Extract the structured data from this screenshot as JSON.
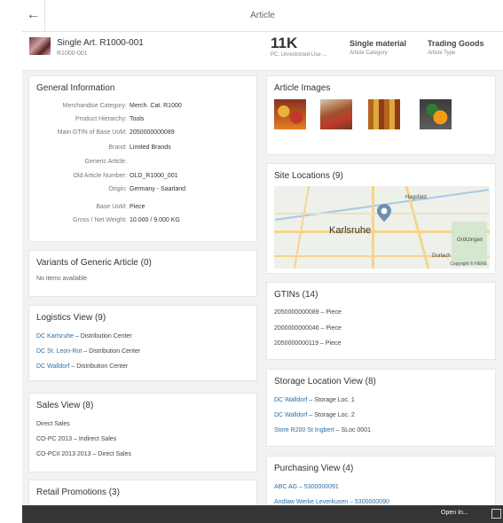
{
  "topbar": {
    "title": "Article",
    "back_icon": "arrow-left-icon"
  },
  "header": {
    "title": "Single Art. R1000-001",
    "subtitle": "R1000-001",
    "kpi_value": "11K",
    "kpi_label": "PC, Unrestricted-Use ...",
    "category_value": "Single material",
    "category_label": "Article Category",
    "type_value": "Trading Goods",
    "type_label": "Article Type"
  },
  "general_info": {
    "title": "General Information",
    "rows": [
      {
        "label": "Merchandise Category:",
        "value": "Merch. Cat. R1000"
      },
      {
        "label": "Product Hierarchy:",
        "value": "Tools"
      },
      {
        "label": "Main GTIN of Base UoM:",
        "value": "2050000000089"
      },
      {
        "label": "Brand:",
        "value": "Limited Brands"
      },
      {
        "label": "Generic Article:",
        "value": ""
      },
      {
        "label": "Old Article Number:",
        "value": "OLD_R1000_001"
      },
      {
        "label": "Origin:",
        "value": "Germany - Saarland"
      },
      {
        "label": "Base UoM:",
        "value": "Piece"
      },
      {
        "label": "Gross / Net Weight:",
        "value": "10.000 / 9.000 KG"
      }
    ]
  },
  "variants": {
    "title": "Variants of Generic Article (0)",
    "empty_text": "No items available"
  },
  "logistics": {
    "title": "Logistics View (9)",
    "items": [
      {
        "link": "DC Karlsruhe",
        "rest": " – Distribution Center"
      },
      {
        "link": "DC St. Leon-Rot",
        "rest": " – Distribution Center"
      },
      {
        "link": "DC Walldorf",
        "rest": " – Distribution Center"
      }
    ]
  },
  "sales": {
    "title": "Sales View (8)",
    "items": [
      {
        "text": "Direct Sales"
      },
      {
        "text": "CO-PC 2013 – Indirect Sales"
      },
      {
        "text": "CO-PCII 2013 2013 – Direct Sales"
      }
    ]
  },
  "retail": {
    "title": "Retail Promotions (3)"
  },
  "article_images": {
    "title": "Article Images"
  },
  "site_locations": {
    "title": "Site Locations (9)",
    "city": "Karlsruhe",
    "labels": {
      "north": "Hagsfeld",
      "east": "Grötzingen",
      "south": "Durlach"
    },
    "copyright": "Copyright © HERE"
  },
  "gtins": {
    "title": "GTINs (14)",
    "items": [
      {
        "text": "2050000000089 – Piece"
      },
      {
        "text": "2000000000046 – Piece"
      },
      {
        "text": "2050000000119 – Piece"
      }
    ]
  },
  "storage": {
    "title": "Storage Location View (8)",
    "items": [
      {
        "link": "DC Walldorf",
        "rest": " – Storage Loc. 1"
      },
      {
        "link": "DC Walldorf",
        "rest": " – Storage Loc. 2"
      },
      {
        "link": "Store R200 St Ingbert",
        "rest": " – SLoc 0001"
      }
    ]
  },
  "purchasing": {
    "title": "Purchasing View (4)",
    "items": [
      {
        "link": "ABC AG – 5300000091",
        "rest": ""
      },
      {
        "link": "Andlaw Werke Leverkusen – 5300000090",
        "rest": ""
      }
    ]
  },
  "bottombar": {
    "open_in_label": "Open In...",
    "share_icon": "share-icon"
  },
  "colors": {
    "link": "#2c6fa8",
    "background": "#f2f2f2",
    "footer": "#353535"
  }
}
